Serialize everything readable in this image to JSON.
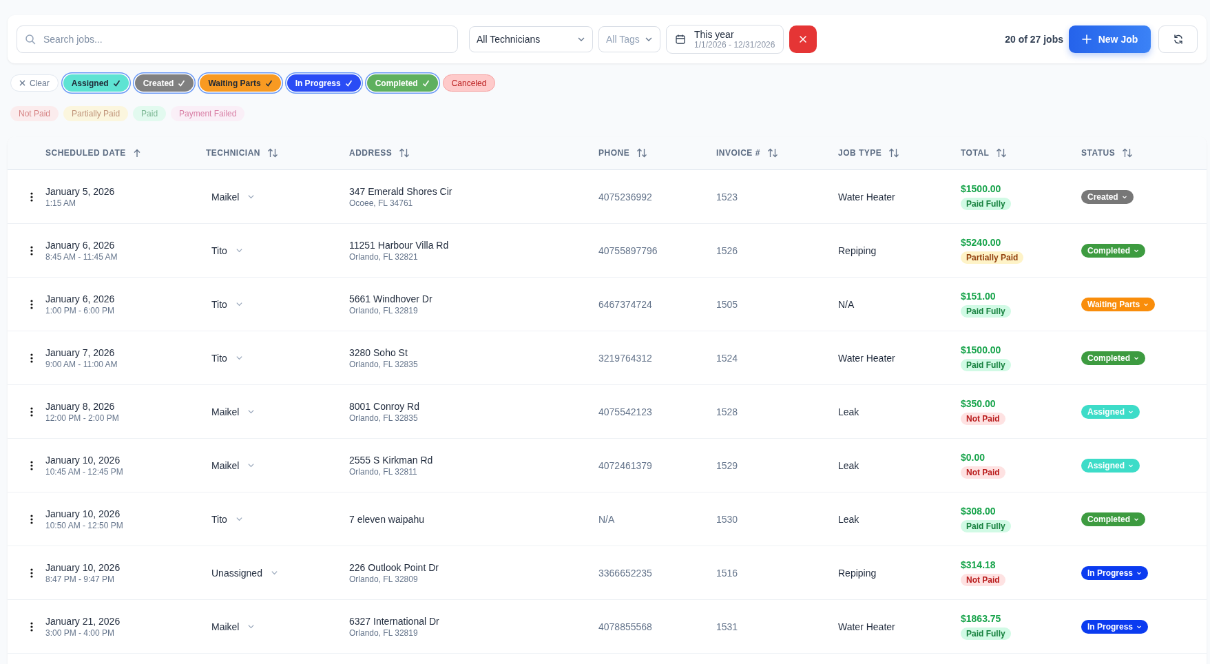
{
  "toolbar": {
    "search": {
      "placeholder": "Search jobs..."
    },
    "technician_filter": "All Technicians",
    "tag_filter": "All Tags",
    "date_range": {
      "label": "This year",
      "range": "1/1/2026 - 12/31/2026"
    },
    "count": "20 of 27 jobs",
    "new_button": "New Job"
  },
  "status_filters": {
    "clear": "Clear",
    "items": [
      {
        "label": "Assigned",
        "selected": true,
        "color": "#5ee3d3",
        "dark_text": true
      },
      {
        "label": "Created",
        "selected": true,
        "color": "#808080",
        "dark_text": false
      },
      {
        "label": "Waiting Parts",
        "selected": true,
        "color": "#f89a22",
        "dark_text": true
      },
      {
        "label": "In Progress",
        "selected": true,
        "color": "#2a4cf5",
        "dark_text": false
      },
      {
        "label": "Completed",
        "selected": true,
        "color": "#5fb05f",
        "dark_text": false
      },
      {
        "label": "Canceled",
        "selected": false,
        "color": "#fecaca",
        "dark_text": true
      }
    ]
  },
  "payment_filters": [
    {
      "label": "Not Paid",
      "selected": false,
      "kind": "not_paid"
    },
    {
      "label": "Partially Paid",
      "selected": false,
      "kind": "partial"
    },
    {
      "label": "Paid",
      "selected": false,
      "kind": "paid"
    },
    {
      "label": "Payment Failed",
      "selected": false,
      "kind": "failed"
    }
  ],
  "table": {
    "columns": [
      {
        "label": "SCHEDULED DATE",
        "sorted": true
      },
      {
        "label": "TECHNICIAN",
        "sorted": false
      },
      {
        "label": "ADDRESS",
        "sorted": false
      },
      {
        "label": "PHONE",
        "sorted": false
      },
      {
        "label": "INVOICE #",
        "sorted": false
      },
      {
        "label": "JOB TYPE",
        "sorted": false
      },
      {
        "label": "TOTAL",
        "sorted": false
      },
      {
        "label": "STATUS",
        "sorted": false
      }
    ],
    "rows": [
      {
        "date": "January 5, 2026",
        "time": "1:15 AM",
        "technician": "Maikel",
        "street": "347 Emerald Shores Cir",
        "city": "Ocoee, FL 34761",
        "phone": "4075236992",
        "invoice": "1523",
        "job_type": "Water Heater",
        "total": "$1500.00",
        "payment": {
          "label": "Paid Fully",
          "kind": "paid"
        },
        "status": {
          "label": "Created",
          "color": "#777777"
        }
      },
      {
        "date": "January 6, 2026",
        "time": "8:45 AM - 11:45 AM",
        "technician": "Tito",
        "street": "11251 Harbour Villa Rd",
        "city": "Orlando, FL 32821",
        "phone": "40755897796",
        "invoice": "1526",
        "job_type": "Repiping",
        "total": "$5240.00",
        "payment": {
          "label": "Partially Paid",
          "kind": "partial"
        },
        "status": {
          "label": "Completed",
          "color": "#3d9b40"
        }
      },
      {
        "date": "January 6, 2026",
        "time": "1:00 PM - 6:00 PM",
        "technician": "Tito",
        "street": "5661 Windhover Dr",
        "city": "Orlando, FL 32819",
        "phone": "6467374724",
        "invoice": "1505",
        "job_type": "N/A",
        "total": "$151.00",
        "payment": {
          "label": "Paid Fully",
          "kind": "paid"
        },
        "status": {
          "label": "Waiting Parts",
          "color": "#f98d0b"
        }
      },
      {
        "date": "January 7, 2026",
        "time": "9:00 AM - 11:00 AM",
        "technician": "Tito",
        "street": "3280 Soho St",
        "city": "Orlando, FL 32835",
        "phone": "3219764312",
        "invoice": "1524",
        "job_type": "Water Heater",
        "total": "$1500.00",
        "payment": {
          "label": "Paid Fully",
          "kind": "paid"
        },
        "status": {
          "label": "Completed",
          "color": "#3d9b40"
        }
      },
      {
        "date": "January 8, 2026",
        "time": "12:00 PM - 2:00 PM",
        "technician": "Maikel",
        "street": "8001 Conroy Rd",
        "city": "Orlando, FL 32835",
        "phone": "4075542123",
        "invoice": "1528",
        "job_type": "Leak",
        "total": "$350.00",
        "payment": {
          "label": "Not Paid",
          "kind": "not_paid"
        },
        "status": {
          "label": "Assigned",
          "color": "#3ddcc8"
        }
      },
      {
        "date": "January 10, 2026",
        "time": "10:45 AM - 12:45 PM",
        "technician": "Maikel",
        "street": "2555 S Kirkman Rd",
        "city": "Orlando, FL 32811",
        "phone": "4072461379",
        "invoice": "1529",
        "job_type": "Leak",
        "total": "$0.00",
        "payment": {
          "label": "Not Paid",
          "kind": "not_paid"
        },
        "status": {
          "label": "Assigned",
          "color": "#3ddcc8"
        }
      },
      {
        "date": "January 10, 2026",
        "time": "10:50 AM - 12:50 PM",
        "technician": "Tito",
        "street": "7 eleven waipahu",
        "phone": "N/A",
        "invoice": "1530",
        "job_type": "Leak",
        "total": "$308.00",
        "payment": {
          "label": "Paid Fully",
          "kind": "paid"
        },
        "status": {
          "label": "Completed",
          "color": "#3d9b40"
        }
      },
      {
        "date": "January 10, 2026",
        "time": "8:47 PM - 9:47 PM",
        "technician": "Unassigned",
        "street": "226 Outlook Point Dr",
        "city": "Orlando, FL 32809",
        "phone": "3366652235",
        "invoice": "1516",
        "job_type": "Repiping",
        "total": "$314.18",
        "payment": {
          "label": "Not Paid",
          "kind": "not_paid"
        },
        "status": {
          "label": "In Progress",
          "color": "#0b3bf0"
        }
      },
      {
        "date": "January 21, 2026",
        "time": "3:00 PM - 4:00 PM",
        "technician": "Maikel",
        "street": "6327 International Dr",
        "city": "Orlando, FL 32819",
        "phone": "4078855568",
        "invoice": "1531",
        "job_type": "Water Heater",
        "total": "$1863.75",
        "payment": {
          "label": "Paid Fully",
          "kind": "paid"
        },
        "status": {
          "label": "In Progress",
          "color": "#0b3bf0"
        }
      }
    ]
  }
}
